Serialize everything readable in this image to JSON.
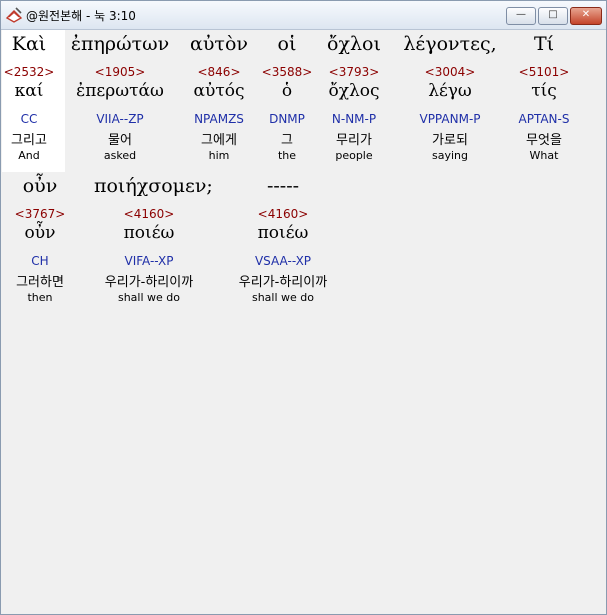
{
  "window": {
    "title": "@원전본해 - 눅 3:10",
    "minimize_label": "—",
    "maximize_label": "□",
    "close_label": "✕"
  },
  "icons": {
    "app": "book-pen-icon"
  },
  "colors": {
    "strong": "#8b0000",
    "morph": "#1f2fa8",
    "highlight": "#ffffff"
  },
  "words": [
    {
      "greek": "Καὶ",
      "strong": "<2532>",
      "lemma": "καί",
      "morph": "CC",
      "korean": "그리고",
      "english": "And"
    },
    {
      "greek": "ἐπηρώτων",
      "strong": "<1905>",
      "lemma": "ἐπερωτάω",
      "morph": "VIIA--ZP",
      "korean": "물어",
      "english": "asked"
    },
    {
      "greek": "αὐτὸν",
      "strong": "<846>",
      "lemma": "αὐτός",
      "morph": "NPAMZS",
      "korean": "그에게",
      "english": "him"
    },
    {
      "greek": "οἱ",
      "strong": "<3588>",
      "lemma": "ὁ",
      "morph": "DNMP",
      "korean": "그",
      "english": "the"
    },
    {
      "greek": "ὄχλοι",
      "strong": "<3793>",
      "lemma": "ὄχλος",
      "morph": "N-NM-P",
      "korean": "무리가",
      "english": "people"
    },
    {
      "greek": "λέγοντες,",
      "strong": "<3004>",
      "lemma": "λέγω",
      "morph": "VPPANM-P",
      "korean": "가로되",
      "english": "saying"
    },
    {
      "greek": "Τί",
      "strong": "<5101>",
      "lemma": "τίς",
      "morph": "APTAN-S",
      "korean": "무엇을",
      "english": "What"
    },
    {
      "greek": "οὖν",
      "strong": "<3767>",
      "lemma": "οὖν",
      "morph": "CH",
      "korean": "그러하면",
      "english": "then"
    },
    {
      "greek": "ποιήχσομεν;",
      "strong": "<4160>",
      "lemma": "ποιέω",
      "morph": "VIFA--XP",
      "korean": "우리가-하리이까",
      "english": "shall we do"
    },
    {
      "greek": "-----",
      "strong": "<4160>",
      "lemma": "ποιέω",
      "morph": "VSAA--XP",
      "korean": "우리가-하리이까",
      "english": "shall we do"
    }
  ]
}
